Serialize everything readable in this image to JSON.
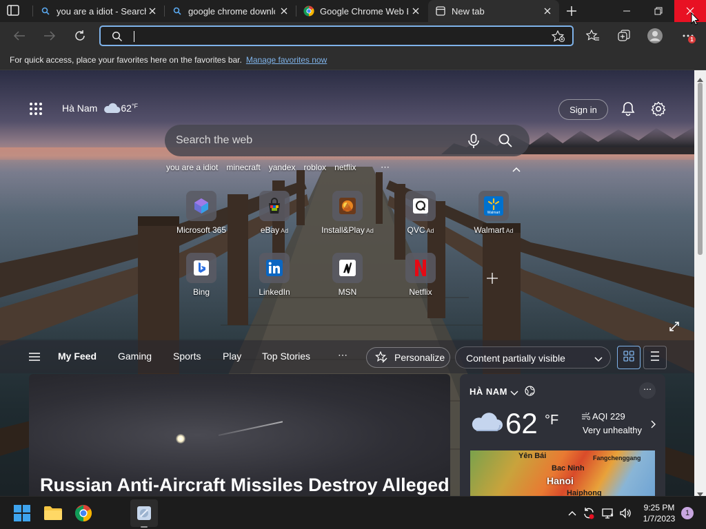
{
  "tabs": [
    {
      "title": "you are a idiot - Search",
      "icon": "search-icon"
    },
    {
      "title": "google chrome downlo",
      "icon": "search-icon"
    },
    {
      "title": "Google Chrome Web Br",
      "icon": "chrome-icon"
    },
    {
      "title": "New tab",
      "icon": "newtab-page-icon",
      "active": true
    }
  ],
  "address": {
    "value": ""
  },
  "favorites_bar": {
    "message": "For quick access, place your favorites here on the favorites bar.",
    "link": "Manage favorites now"
  },
  "toolbar": {
    "notification_count": "1"
  },
  "ntp": {
    "location": "Hà Nam",
    "temp": "62",
    "temp_unit": "°F",
    "sign_in": "Sign in",
    "search_placeholder": "Search the web",
    "trending": [
      "you are a idiot",
      "minecraft",
      "yandex",
      "roblox",
      "netflix"
    ],
    "trending_more": "⋯",
    "tiles": [
      {
        "label": "Microsoft 365",
        "ad": "",
        "icon": "microsoft365-icon"
      },
      {
        "label": "eBay",
        "ad": "Ad",
        "icon": "ebay-icon"
      },
      {
        "label": "Install&Play",
        "ad": "Ad",
        "icon": "installplay-icon"
      },
      {
        "label": "QVC",
        "ad": "Ad",
        "icon": "qvc-icon"
      },
      {
        "label": "Walmart",
        "ad": "Ad",
        "icon": "walmart-icon"
      },
      {
        "label": "Bing",
        "ad": "",
        "icon": "bing-icon"
      },
      {
        "label": "LinkedIn",
        "ad": "",
        "icon": "linkedin-icon"
      },
      {
        "label": "MSN",
        "ad": "",
        "icon": "msn-icon"
      },
      {
        "label": "Netflix",
        "ad": "",
        "icon": "netflix-icon"
      }
    ],
    "walmart_small": "Walmart"
  },
  "feed": {
    "tabs": [
      "My Feed",
      "Gaming",
      "Sports",
      "Play",
      "Top Stories"
    ],
    "more": "⋯",
    "personalize": "Personalize",
    "visibility": "Content partially visible"
  },
  "news": {
    "headline": "Russian Anti-Aircraft Missiles Destroy Alleged"
  },
  "weather": {
    "location": "HÀ NAM",
    "temp": "62",
    "unit": "°F",
    "aqi": "AQI 229",
    "aqi_desc": "Very unhealthy",
    "more": "⋯",
    "map_labels": {
      "yenbai": "Yên Bái",
      "fangcheng": "Fangchenggang",
      "bacninh": "Bac Ninh",
      "hanoi": "Hanoi",
      "haiphong": "Haiphong"
    }
  },
  "taskbar": {
    "time": "9:25 PM",
    "date": "1/7/2023",
    "notifications": "1"
  },
  "colors": {
    "accent": "#7fb3ea",
    "close_red": "#e81123",
    "tab_bg": "#202020",
    "toolbar_bg": "#2e2e2e"
  }
}
